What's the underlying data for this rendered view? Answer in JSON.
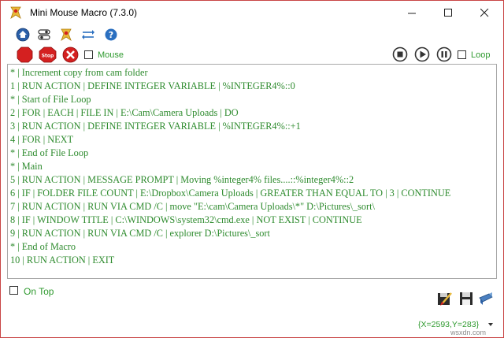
{
  "window": {
    "title": "Mini Mouse Macro (7.3.0)",
    "controls": {
      "minimize": "—",
      "maximize": "☐",
      "close": "✕"
    }
  },
  "toolbar_top": {
    "icons": [
      "home-icon",
      "settings-toggle-icon",
      "badge-icon",
      "arrows-icon",
      "help-icon"
    ]
  },
  "toolbar_second": {
    "mouse_label": "Mouse",
    "loop_label": "Loop"
  },
  "script_lines": [
    "* | Increment copy from cam folder",
    "1 | RUN ACTION | DEFINE INTEGER VARIABLE | %INTEGER4%::0",
    "* | Start of File Loop",
    "2 | FOR | EACH | FILE IN | E:\\Cam\\Camera Uploads | DO",
    "3 | RUN ACTION | DEFINE INTEGER VARIABLE | %INTEGER4%::+1",
    "4 | FOR | NEXT",
    "* | End of File Loop",
    "* | Main",
    "5 | RUN ACTION | MESSAGE PROMPT | Moving %integer4% files....::%integer4%::2",
    "6 | IF | FOLDER FILE COUNT | E:\\Dropbox\\Camera Uploads | GREATER THAN EQUAL TO | 3 | CONTINUE",
    "7 | RUN ACTION | RUN VIA CMD /C | move \"E:\\cam\\Camera Uploads\\*\" D:\\Pictures\\_sort\\",
    "8 | IF | WINDOW TITLE | C:\\WINDOWS\\system32\\cmd.exe | NOT EXIST | CONTINUE",
    "9 | RUN ACTION | RUN VIA CMD /C | explorer D:\\Pictures\\_sort",
    "* | End of Macro",
    "10 | RUN ACTION | EXIT"
  ],
  "bottom": {
    "on_top_label": "On Top",
    "coordinates": "{X=2593,Y=283}",
    "watermark": "wsxdn.com"
  },
  "colors": {
    "border": "#c94545",
    "script_text": "#2e8b2e",
    "label_green": "#2f9a2f",
    "stop_red": "#d42020"
  }
}
